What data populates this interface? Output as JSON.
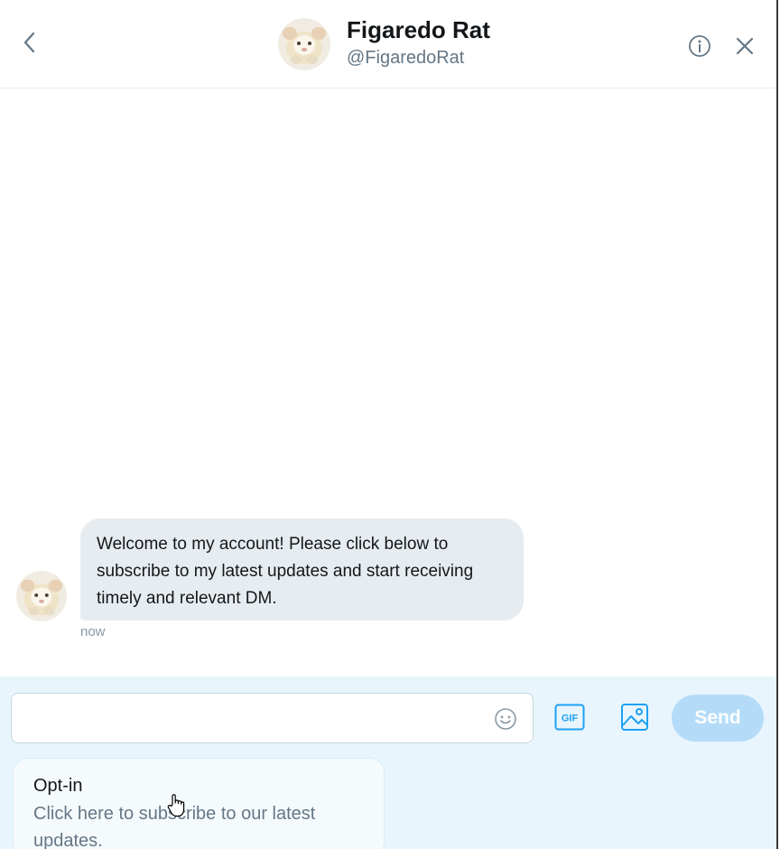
{
  "header": {
    "name": "Figaredo Rat",
    "handle": "@FigaredoRat"
  },
  "messages": [
    {
      "text": "Welcome to my account!  Please click below to subscribe to my latest updates and start receiving timely and relevant DM.",
      "time": "now"
    }
  ],
  "composer": {
    "input_value": "",
    "gif_label": "GIF",
    "send_label": "Send"
  },
  "quick_reply": {
    "label": "Opt-in",
    "description": "Click here to subscribe to our latest updates."
  },
  "colors": {
    "accent": "#1da1f2",
    "send_disabled": "#b4dcf8",
    "bubble": "#e6ecf0",
    "composer_bg": "#e8f5fd"
  },
  "icons": [
    "chevron-left-icon",
    "info-icon",
    "close-icon",
    "emoji-icon",
    "gif-icon",
    "image-icon",
    "hand-cursor-icon"
  ]
}
